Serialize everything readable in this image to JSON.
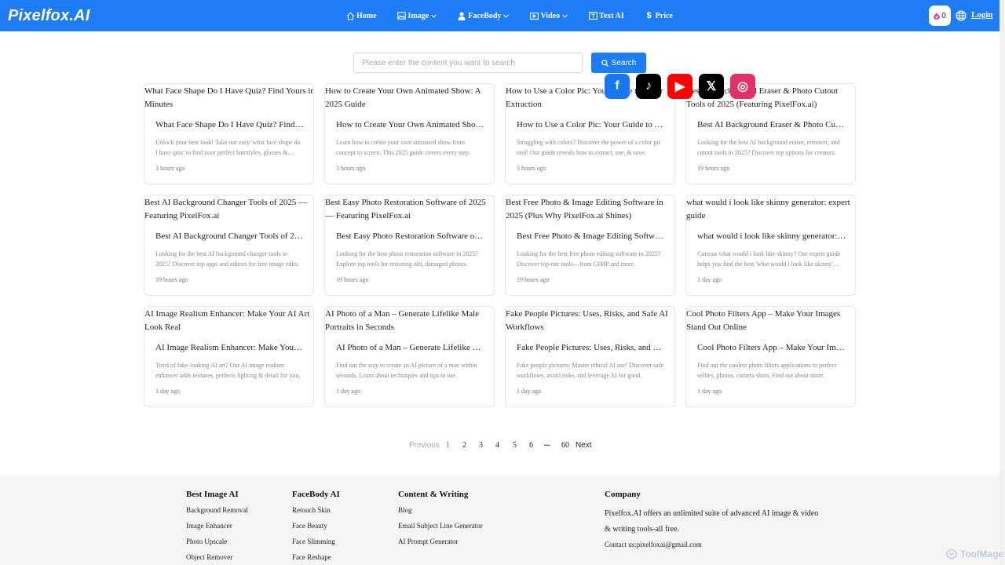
{
  "header": {
    "logo": "Pixelfox.AI",
    "nav": [
      {
        "label": "Home",
        "icon": "home-icon",
        "dropdown": false
      },
      {
        "label": "Image",
        "icon": "image-icon",
        "dropdown": true
      },
      {
        "label": "FaceBody",
        "icon": "facebody-icon",
        "dropdown": true
      },
      {
        "label": "Video",
        "icon": "video-icon",
        "dropdown": true
      },
      {
        "label": "Text AI",
        "icon": "text-ai-icon",
        "dropdown": false
      },
      {
        "label": "Price",
        "icon": "dollar-icon",
        "dropdown": false
      }
    ],
    "credits": "0",
    "login": "Login"
  },
  "search": {
    "placeholder": "Please enter the content you want to search",
    "button": "Search"
  },
  "cards": [
    {
      "alt": "What Face Shape Do I Have Quiz? Find Yours in Minutes",
      "title": "What Face Shape Do I Have Quiz? Find Yours in Minutes",
      "desc": "Unlock your best look! Take our easy 'what face shape do I have quiz' to find your perfect hairstyles, glasses & makeup.",
      "time": "3 hours ago"
    },
    {
      "alt": "How to Create Your Own Animated Show: A 2025 Guide",
      "title": "How to Create Your Own Animated Show: A 2025 Guide",
      "desc": "Learn how to create your own animated show from concept to screen. This 2025 guide covers every step.",
      "time": "3 hours ago"
    },
    {
      "alt": "How to Use a Color Pic: Your Guide to Color Extraction",
      "title": "How to Use a Color Pic: Your Guide to Color Extraction",
      "desc": "Struggling with colors? Discover the power of a color pic tool! Our guide reveals how to extract, use, & save.",
      "time": "3 hours ago"
    },
    {
      "alt": "Best AI Background Eraser & Photo Cutout Tools of 2025 (Featuring PixelFox.ai)",
      "title": "Best AI Background Eraser & Photo Cutout Tools of 2025",
      "desc": "Looking for the best AI background eraser, remover, and cutout tools in 2025? Discover top options for creators.",
      "time": "19 hours ago"
    },
    {
      "alt": "Best AI Background Changer Tools of 2025 — Featuring PixelFox.ai",
      "title": "Best AI Background Changer Tools of 2025 — Featuring PixelFox.ai",
      "desc": "Looking for the best AI background changer tools in 2025? Discover top apps and editors for free image edits.",
      "time": "19 hours ago"
    },
    {
      "alt": "Best Easy Photo Restoration Software of 2025 — Featuring PixelFox.ai",
      "title": "Best Easy Photo Restoration Software of 2025 — Featuring PixelFox.ai",
      "desc": "Looking for the best photo restoration software in 2025? Explore top tools for restoring old, damaged photos.",
      "time": "19 hours ago"
    },
    {
      "alt": "Best Free Photo & Image Editing Software in 2025 (Plus Why PixelFox.ai Shines)",
      "title": "Best Free Photo & Image Editing Software in 2025",
      "desc": "Looking for the best free photo editing software in 2025? Discover top-tier tools—from GIMP and more.",
      "time": "19 hours ago"
    },
    {
      "alt": "what would i look like skinny generator: expert guide",
      "title": "what would i look like skinny generator: expert guide",
      "desc": "Curious what would i look like skinny? Our expert guide helps you find the best 'what would i look like skinny' tools.",
      "time": "1 day ago"
    },
    {
      "alt": "AI Image Realism Enhancer: Make Your AI Art Look Real",
      "title": "AI Image Realism Enhancer: Make Your AI Art Look Real",
      "desc": "Tired of fake-looking AI art? Our AI image realism enhancer adds textures, perfects lighting & detail for you.",
      "time": "1 day ago"
    },
    {
      "alt": "AI Photo of a Man – Generate Lifelike Male Portraits in Seconds",
      "title": "AI Photo of a Man – Generate Lifelike Male Portraits in Seconds",
      "desc": "Find out the way to create an AI picture of a man within seconds. Learn about techniques and tips to use.",
      "time": "1 day ago"
    },
    {
      "alt": "Fake People Pictures: Uses, Risks, and Safe AI Workflows",
      "title": "Fake People Pictures: Uses, Risks, and Safe AI Workflows",
      "desc": "Fake people pictures: Master ethical AI use! Discover safe workflows, avoid risks, and leverage AI for good.",
      "time": "1 day ago"
    },
    {
      "alt": "Cool Photo Filters App – Make Your Images Stand Out Online",
      "title": "Cool Photo Filters App – Make Your Images Stand Out Online",
      "desc": "Find out the coolest photo filters applications to perfect selfies, photos, camera shots. Find out about more.",
      "time": "1 day ago"
    }
  ],
  "pagination": {
    "previous": "Previous",
    "pages": [
      "1",
      "2",
      "3",
      "4",
      "5",
      "6"
    ],
    "ellipsis": "•••",
    "last": "60",
    "next": "Next",
    "current": "1"
  },
  "footer": {
    "columns": [
      {
        "heading": "Best Image AI",
        "links": [
          "Background Removal",
          "Image Enhancer",
          "Photo Upscale",
          "Object Remover"
        ]
      },
      {
        "heading": "FaceBody AI",
        "links": [
          "Retouch Skin",
          "Face Beauty",
          "Face Slimming",
          "Face Reshape"
        ]
      },
      {
        "heading": "Content & Writing",
        "links": [
          "Blog",
          "Email Subject Line Generator",
          "AI Prompt Generator"
        ]
      }
    ],
    "company": {
      "heading": "Company",
      "desc": "Pixelfox.AI offers an unlimited suite of advanced AI image & video & writing tools-all free.",
      "contact": "Contact us:pixelfoxai@gmail.com"
    },
    "socials": [
      {
        "name": "facebook-icon",
        "color": "#1877f2",
        "glyph": "f"
      },
      {
        "name": "tiktok-icon",
        "color": "#000000",
        "glyph": "♪"
      },
      {
        "name": "youtube-icon",
        "color": "#ff0000",
        "glyph": "▶"
      },
      {
        "name": "x-icon",
        "color": "#000000",
        "glyph": "𝕏"
      },
      {
        "name": "instagram-icon",
        "color": "#e1306c",
        "glyph": "◎"
      }
    ]
  },
  "watermark": "ToolMage",
  "colors": {
    "brand": "#1e7cf6"
  }
}
